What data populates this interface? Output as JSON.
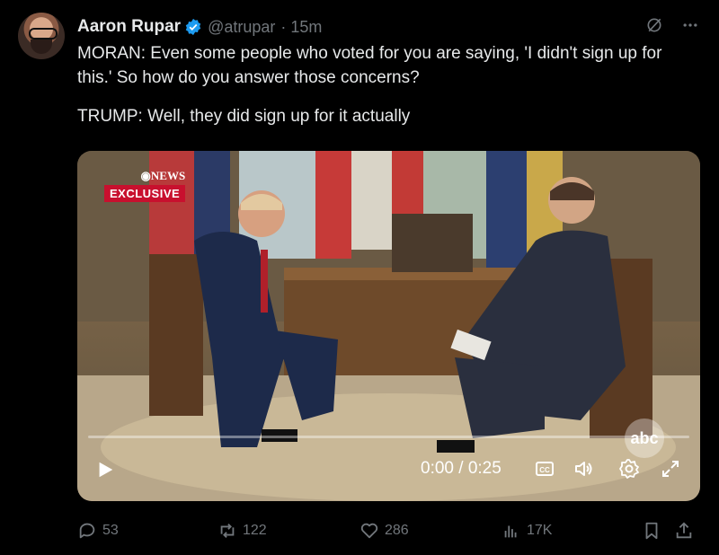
{
  "author": {
    "name": "Aaron Rupar",
    "handle": "@atrupar",
    "time": "· 15m",
    "verified": true
  },
  "tweet": {
    "paragraph1": "MORAN: Even some people who voted for you are saying, 'I didn't sign up for this.' So how do you answer those concerns?",
    "paragraph2": "TRUMP: Well, they did sign up for it actually"
  },
  "video": {
    "network_label": "NEWS",
    "exclusive_label": "EXCLUSIVE",
    "watermark": "abc",
    "time_display": "0:00 / 0:25",
    "progress": 0.0
  },
  "actions": {
    "replies": "53",
    "reposts": "122",
    "likes": "286",
    "views": "17K"
  },
  "colors": {
    "accent_blue": "#1d9bf0",
    "muted": "#71767b",
    "exclusive_red": "#c8102e"
  },
  "icons": [
    "grok-icon",
    "more-icon",
    "play-icon",
    "captions-icon",
    "volume-icon",
    "settings-icon",
    "fullscreen-icon",
    "reply-icon",
    "repost-icon",
    "like-icon",
    "views-icon",
    "bookmark-icon",
    "share-icon"
  ]
}
